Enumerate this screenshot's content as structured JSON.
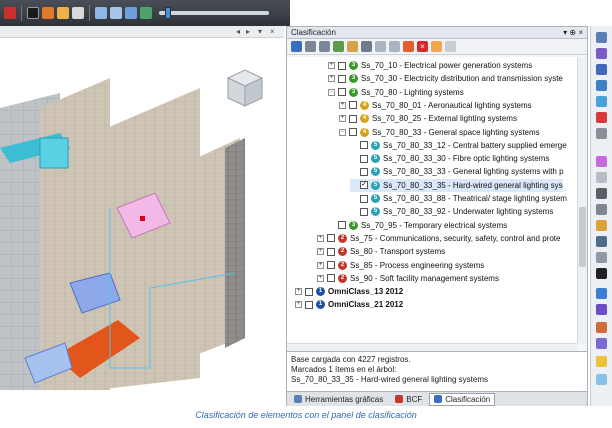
{
  "panel": {
    "title": "Clasificación",
    "pin_label": "▾ ⊕ ×"
  },
  "tree": [
    {
      "indent": 3,
      "exp": "+",
      "badge": "3",
      "color": "#3a9a2a",
      "label": "Ss_70_10 - Electrical power generation systems",
      "checked": false,
      "bold": false
    },
    {
      "indent": 3,
      "exp": "+",
      "badge": "3",
      "color": "#3a9a2a",
      "label": "Ss_70_30 - Electricity distribution and transmission syste",
      "checked": false,
      "bold": false
    },
    {
      "indent": 3,
      "exp": "-",
      "badge": "3",
      "color": "#3a9a2a",
      "label": "Ss_70_80 - Lighting systems",
      "checked": false,
      "bold": false
    },
    {
      "indent": 4,
      "exp": "+",
      "badge": "4",
      "color": "#d6a21a",
      "label": "Ss_70_80_01 - Aeronautical lighting systems",
      "checked": false,
      "bold": false
    },
    {
      "indent": 4,
      "exp": "+",
      "badge": "4",
      "color": "#d6a21a",
      "label": "Ss_70_80_25 - External lighting systems",
      "checked": false,
      "bold": false
    },
    {
      "indent": 4,
      "exp": "-",
      "badge": "4",
      "color": "#d6a21a",
      "label": "Ss_70_80_33 - General space lighting systems",
      "checked": false,
      "bold": false
    },
    {
      "indent": 5,
      "exp": "",
      "badge": "5",
      "color": "#2aa3b8",
      "label": "Ss_70_80_33_12 - Central battery supplied emerge",
      "checked": false,
      "bold": false
    },
    {
      "indent": 5,
      "exp": "",
      "badge": "5",
      "color": "#2aa3b8",
      "label": "Ss_70_80_33_30 - Fibre optic lighting systems",
      "checked": false,
      "bold": false
    },
    {
      "indent": 5,
      "exp": "",
      "badge": "5",
      "color": "#2aa3b8",
      "label": "Ss_70_80_33_33 - General lighting systems with p",
      "checked": false,
      "bold": false
    },
    {
      "indent": 5,
      "exp": "",
      "badge": "5",
      "color": "#2aa3b8",
      "label": "Ss_70_80_33_35 - Hard-wired general lighting sys",
      "checked": true,
      "bold": false
    },
    {
      "indent": 5,
      "exp": "",
      "badge": "5",
      "color": "#2aa3b8",
      "label": "Ss_70_80_33_88 - Theatrical/ stage lighting system",
      "checked": false,
      "bold": false
    },
    {
      "indent": 5,
      "exp": "",
      "badge": "5",
      "color": "#2aa3b8",
      "label": "Ss_70_80_33_92 - Underwater lighting systems",
      "checked": false,
      "bold": false
    },
    {
      "indent": 3,
      "exp": "",
      "badge": "3",
      "color": "#3a9a2a",
      "label": "Ss_70_95 - Temporary electrical systems",
      "checked": false,
      "bold": false
    },
    {
      "indent": 2,
      "exp": "+",
      "badge": "2",
      "color": "#c0392b",
      "label": "Ss_75 - Communications, security, safety, control and prote",
      "checked": false,
      "bold": false
    },
    {
      "indent": 2,
      "exp": "+",
      "badge": "2",
      "color": "#c0392b",
      "label": "Ss_80 - Transport systems",
      "checked": false,
      "bold": false
    },
    {
      "indent": 2,
      "exp": "+",
      "badge": "2",
      "color": "#c0392b",
      "label": "Ss_85 - Process engineering systems",
      "checked": false,
      "bold": false
    },
    {
      "indent": 2,
      "exp": "+",
      "badge": "2",
      "color": "#c0392b",
      "label": "Ss_90 - Soft facility management systems",
      "checked": false,
      "bold": false
    },
    {
      "indent": 0,
      "exp": "+",
      "badge": "1",
      "color": "#1e4fa8",
      "label": "OmniClass_13 2012",
      "checked": false,
      "bold": true
    },
    {
      "indent": 0,
      "exp": "+",
      "badge": "1",
      "color": "#1e4fa8",
      "label": "OmniClass_21 2012",
      "checked": false,
      "bold": true
    }
  ],
  "status": {
    "line1": "Base cargada con 4227 registros.",
    "line2": "Marcados 1 ítems en el árbol:",
    "line3": "Ss_70_80_33_35 - Hard-wired general lighting systems"
  },
  "tabs": [
    {
      "label": "Herramientas gráficas",
      "active": false,
      "color": "#5b7fb5"
    },
    {
      "label": "BCF",
      "active": false,
      "color": "#c0392b"
    },
    {
      "label": "Clasificación",
      "active": true,
      "color": "#3a6ebd"
    }
  ],
  "caption": "Clasificación de elementos con el panel de clasificación",
  "colors": {
    "checked_highlight": "#dbe8f7",
    "badge_level_1": "#1e4fa8",
    "badge_level_2": "#c0392b",
    "badge_level_3": "#3a9a2a",
    "badge_level_4": "#d6a21a",
    "badge_level_5": "#2aa3b8"
  }
}
